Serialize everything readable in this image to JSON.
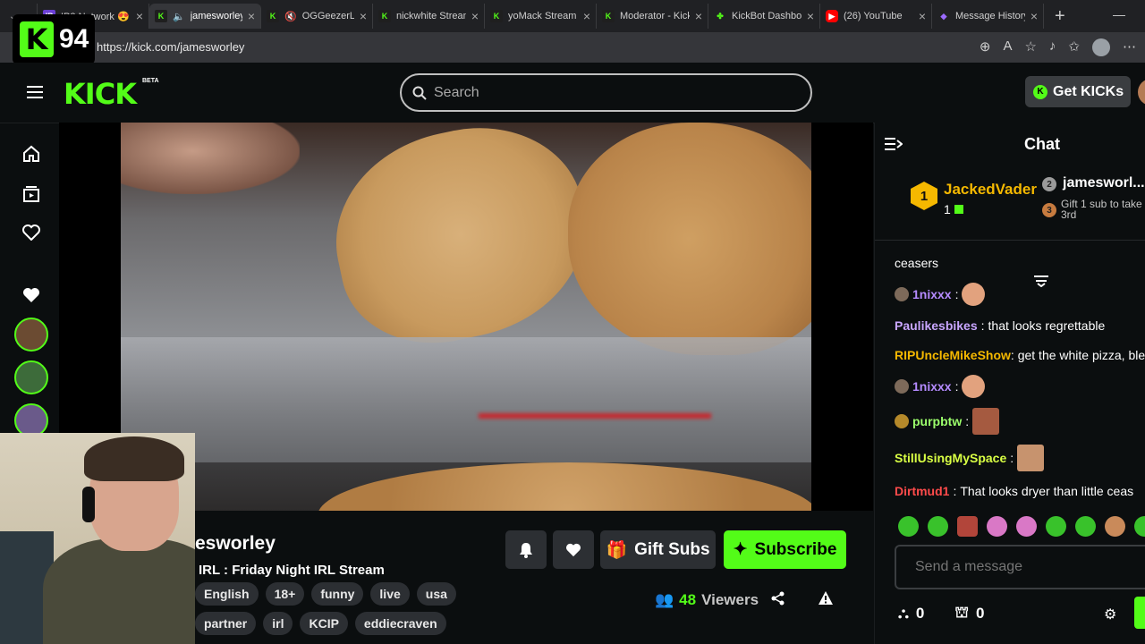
{
  "browser": {
    "tabs": [
      {
        "title": "IP2 Network 😍",
        "icon": "ip2-icon",
        "active": false
      },
      {
        "title": "jamesworley",
        "icon": "kick-icon",
        "active": true
      },
      {
        "title": "OGGeezerL",
        "icon": "kick-icon",
        "active": false
      },
      {
        "title": "nickwhite Stream",
        "icon": "kick-icon",
        "active": false
      },
      {
        "title": "yoMack Stream",
        "icon": "kick-icon",
        "active": false
      },
      {
        "title": "Moderator - Kick",
        "icon": "kick-icon",
        "active": false
      },
      {
        "title": "KickBot Dashbo",
        "icon": "kickbot-icon",
        "active": false
      },
      {
        "title": "(26) YouTube",
        "icon": "youtube-icon",
        "active": false
      },
      {
        "title": "Message History",
        "icon": "message-icon",
        "active": false
      }
    ],
    "new_tab": "+",
    "url": "https://kick.com/jamesworley"
  },
  "overlay_badge": {
    "letter": "K",
    "value": "94"
  },
  "header": {
    "logo": "KICK",
    "beta": "BETA",
    "search_placeholder": "Search",
    "get_kicks": "Get KICKs"
  },
  "stream": {
    "name": "jamesworley",
    "name_visible": "esworley",
    "title": "IRL : Friday Night IRL Stream",
    "tags_row1": [
      "English",
      "18+",
      "funny",
      "live",
      "usa"
    ],
    "tags_row2": [
      "partner",
      "irl",
      "KCIP",
      "eddiecraven"
    ],
    "gift_subs": "Gift Subs",
    "subscribe": "Subscribe",
    "viewers_count": "48",
    "viewers_label": "Viewers"
  },
  "chat": {
    "title": "Chat",
    "leaderboard": {
      "first": {
        "rank": "1",
        "name": "JackedVader",
        "value": "1"
      },
      "second": {
        "rank": "2",
        "name": "jamesworl..."
      },
      "third": {
        "rank": "3",
        "cta": "Gift 1 sub to take 3rd"
      }
    },
    "messages": [
      {
        "user": "",
        "text": "ceasers",
        "color": "#ffffff"
      },
      {
        "user": "1nixxx",
        "text": "",
        "color": "#b58bff",
        "emote": true
      },
      {
        "user": "Paulikesbikes",
        "text": "that looks regrettable",
        "color": "#c9a6ff"
      },
      {
        "user": "RIPUncleMikeShow",
        "text": "get the white pizza, blek",
        "color": "#f5b800"
      },
      {
        "user": "1nixxx",
        "text": "",
        "color": "#b58bff",
        "emote": true
      },
      {
        "user": "purpbtw",
        "text": "",
        "color": "#9cff6c",
        "emote": true
      },
      {
        "user": "StillUsingMySpace",
        "text": "",
        "color": "#d9ff44",
        "emote": true
      },
      {
        "user": "Dirtmud1",
        "text": "That looks dryer than little ceas",
        "color": "#ff4b4b"
      }
    ],
    "input_placeholder": "Send a message",
    "points": "0",
    "drops": "0"
  },
  "colors": {
    "accent": "#53fc18",
    "background": "#0b0e0f",
    "gold": "#f5b800"
  }
}
